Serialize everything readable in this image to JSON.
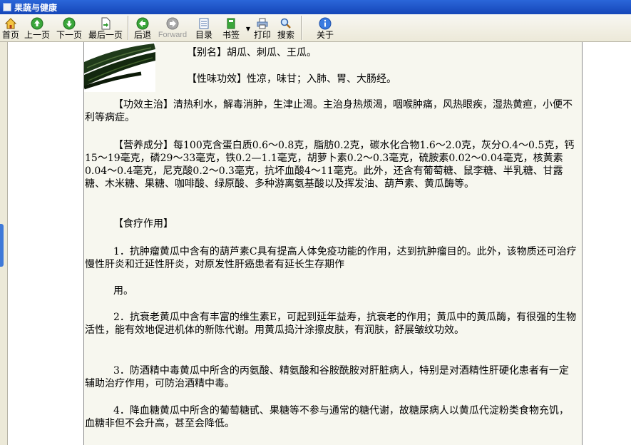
{
  "window": {
    "title": "果蔬与健康"
  },
  "toolbar": {
    "home": "首页",
    "prev": "上一页",
    "next": "下一页",
    "last": "最后一页",
    "back": "后退",
    "forward": "Forward",
    "contents": "目录",
    "bookmark": "书签",
    "print": "打印",
    "search": "搜索",
    "about": "关于"
  },
  "content": {
    "alias": "【别名】胡瓜、刺瓜、王瓜。",
    "nature": "【性味功效】性凉，味甘；入肺、胃、大肠经。",
    "effect": "【功效主治】清热利水，解毒消肿，生津止渴。主治身热烦渴，咽喉肿痛，风热眼疾，湿热黄疸，小便不利等病症。",
    "nutrition": "【营养成分】每100克含蛋白质0.6～0.8克，脂肪0.2克，碳水化合物1.6～2.0克，灰分O.4～0.5克，钙15～19毫克，磷29～33毫克，铁0.2—1.1毫克，胡萝卜素0.2～0.3毫克，硫胺素0.02～0.04毫克，核黄素0.04～0.4毫克，尼克酸0.2～0.3毫克，抗坏血酸4～11毫克。此外，还含有葡萄糖、鼠李糖、半乳糖、甘露糖、木米糖、果糖、咖啡酸、绿原酸、多种游离氨基酸以及挥发油、葫芦素、黄瓜酶等。",
    "dietary": "【食疗作用】",
    "item1": "1．抗肿瘤黄瓜中含有的葫芦素C具有提高人体免疫功能的作用，达到抗肿瘤目的。此外，该物质还可治疗慢性肝炎和迁延性肝炎，对原发性肝癌患者有延长生存期作",
    "item1b": "用。",
    "item2": "2．抗衰老黄瓜中含有丰富的维生素E，可起到延年益寿，抗衰老的作用；黄瓜中的黄瓜酶，有很强的生物活性，能有效地促进机体的新陈代谢。用黄瓜捣汁涂擦皮肤，有润肤，舒展皱纹功效。",
    "item3": "3．防酒精中毒黄瓜中所含的丙氨酸、精氨酸和谷胺酰胺对肝脏病人，特别是对酒精性肝硬化患者有一定辅助治疗作用，可防治酒精中毒。",
    "item4": "4．降血糖黄瓜中所含的葡萄糖甙、果糖等不参与通常的糖代谢，故糖尿病人以黄瓜代淀粉类食物充饥，血糖非但不会升高，甚至会降低。"
  }
}
